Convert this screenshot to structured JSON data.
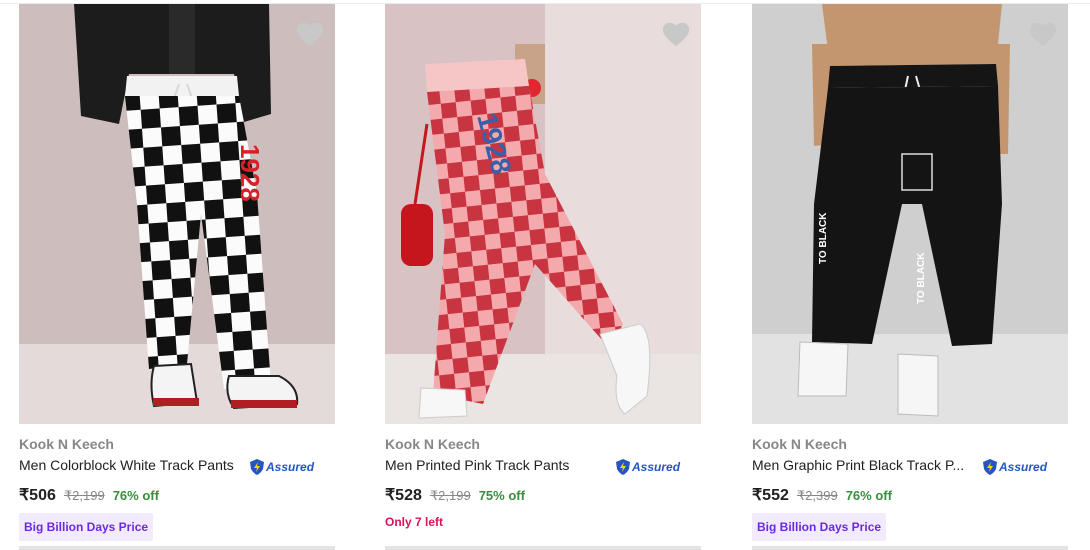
{
  "products": [
    {
      "brand": "Kook N Keech",
      "title": "Men Colorblock White Track Pants",
      "assured": "Assured",
      "price": "₹506",
      "mrp": "₹2,199",
      "discount": "76% off",
      "tag": "Big Billion Days Price",
      "image_icon": "checkered-track-pants-photo"
    },
    {
      "brand": "Kook N Keech",
      "title": "Men Printed Pink Track Pants",
      "assured": "Assured",
      "price": "₹528",
      "mrp": "₹2,199",
      "discount": "75% off",
      "stock_note": "Only 7 left",
      "image_icon": "pink-checkered-track-pants-photo"
    },
    {
      "brand": "Kook N Keech",
      "title": "Men Graphic Print Black Track P...",
      "assured": "Assured",
      "price": "₹552",
      "mrp": "₹2,399",
      "discount": "76% off",
      "tag": "Big Billion Days Price",
      "image_icon": "black-cargo-joggers-photo"
    }
  ],
  "colors": {
    "discount": "#388e3c",
    "assured": "#2455c3",
    "tag_bg": "#f1ebfd",
    "tag_text": "#6b2ae0",
    "stock_note": "#d4145a",
    "wishlist_heart": "#c8c8c8"
  }
}
